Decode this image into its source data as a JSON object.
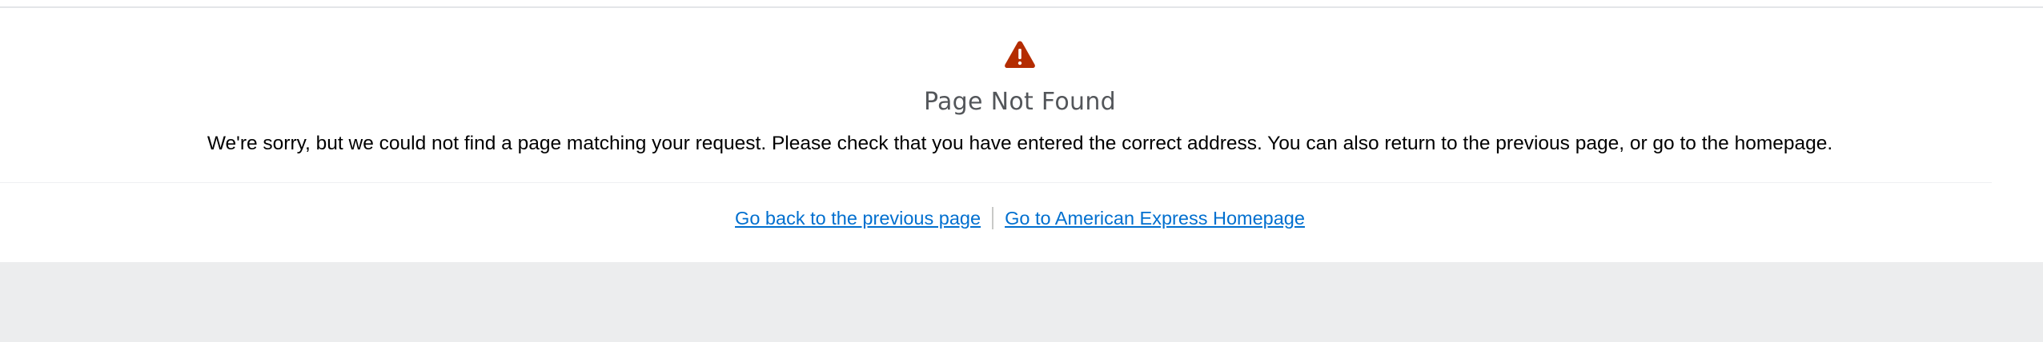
{
  "error": {
    "icon": "warning-triangle-icon",
    "icon_color": "#b42c01",
    "title": "Page Not Found",
    "message": "We're sorry, but we could not find a page matching your request. Please check that you have entered the correct address. You can also return to the previous page, or go to the homepage."
  },
  "links": {
    "back_label": "Go back to the previous page",
    "home_label": "Go to American Express Homepage",
    "link_color": "#006fcf"
  },
  "colors": {
    "title": "#53565a",
    "footer_background": "#ecedee"
  }
}
